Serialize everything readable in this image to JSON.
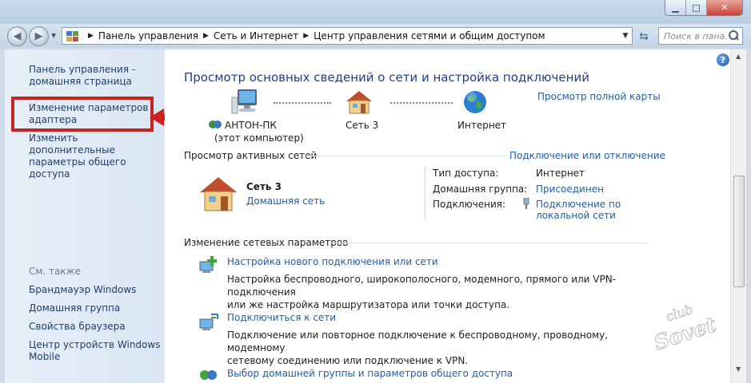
{
  "window": {
    "title": "",
    "buttons": {
      "minimize": "▁",
      "maximize": "□",
      "close": "✕"
    }
  },
  "address_bar": {
    "crumbs": [
      "Панель управления",
      "Сеть и Интернет",
      "Центр управления сетями и общим доступом"
    ],
    "search_placeholder": "Поиск в пана..."
  },
  "left_pane": {
    "home_link": "Панель управления -\nдомашняя страница",
    "adapter_link": "Изменение параметров\nадаптера",
    "advanced_link": "Изменить дополнительные\nпараметры общего доступа",
    "see_also": "См. также",
    "see_also_links": [
      "Брандмауэр Windows",
      "Домашняя группа",
      "Свойства браузера",
      "Центр устройств Windows\nMobile"
    ]
  },
  "main": {
    "title": "Просмотр основных сведений о сети и настройка подключений",
    "full_map_link": "Просмотр полной карты",
    "map_nodes": [
      {
        "label": "АНТОН-ПК",
        "sublabel": "(этот компьютер)",
        "icon": "computer-icon"
      },
      {
        "label": "Сеть 3",
        "icon": "house-icon"
      },
      {
        "label": "Интернет",
        "icon": "globe-icon"
      }
    ],
    "active_networks_title": "Просмотр активных сетей",
    "connect_disconnect_link": "Подключение или отключение",
    "network": {
      "name": "Сеть 3",
      "type": "Домашняя сеть",
      "access_type_label": "Тип доступа:",
      "access_type_value": "Интернет",
      "homegroup_label": "Домашняя группа:",
      "homegroup_value": "Присоединен",
      "connections_label": "Подключения:",
      "connections_value": "Подключение по\nлокальной сети"
    },
    "change_settings_title": "Изменение сетевых параметров",
    "tasks": [
      {
        "link": "Настройка нового подключения или сети",
        "desc": "Настройка беспроводного, широкополосного, модемного, прямого или VPN-подключения\nили же настройка маршрутизатора или точки доступа."
      },
      {
        "link": "Подключиться к сети",
        "desc": "Подключение или повторное подключение к беспроводному, проводному, модемному\nсетевому соединению или подключение к VPN."
      },
      {
        "link": "Выбор домашней группы и параметров общего доступа",
        "desc": ""
      }
    ]
  },
  "watermark": "club Sovet",
  "colors": {
    "link": "#1f5fa8",
    "title": "#1c3f8a",
    "highlight": "#c8231f",
    "left_pane": "#dae6f3"
  }
}
